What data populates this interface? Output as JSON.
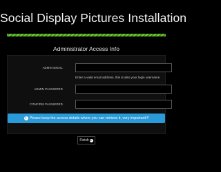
{
  "page": {
    "title": "Social Display Pictures Installation",
    "progress_percent": 100,
    "progress_color": "#6ec63c"
  },
  "form": {
    "heading": "Administrator Access Info",
    "email_label": "ADMIN EMAIL",
    "email_value": "",
    "email_help": "Enter a valid email address, this is also your login username",
    "password_label": "ADMIN PASSWORD",
    "password_value": "",
    "confirm_label": "CONFIRM PASSWORD",
    "confirm_value": ""
  },
  "alert": {
    "icon": "info-icon",
    "icon_glyph": "i",
    "text": "Please keep the access details where you can retrieve it, very important!!!",
    "color": "#2a9ad8"
  },
  "actions": {
    "finish_label": "Finish",
    "finish_icon": "arrow-right-circle-icon",
    "finish_glyph": "▸"
  }
}
